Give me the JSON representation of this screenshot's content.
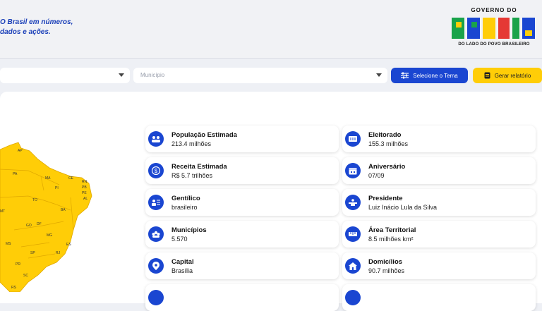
{
  "header": {
    "tagline_line1": "O Brasil em números,",
    "tagline_line2": "dados e ações.",
    "logo_top": "GOVERNO DO",
    "logo_main": "BRASIL",
    "logo_bottom": "DO LADO DO POVO BRASILEIRO"
  },
  "filters": {
    "municipio_placeholder": "Município",
    "theme_button": "Selecione o Tema",
    "report_button": "Gerar relatório"
  },
  "map": {
    "fill_color": "#ffcd07",
    "states": [
      "AP",
      "PA",
      "MA",
      "CE",
      "RN",
      "PB",
      "PE",
      "AL",
      "PI",
      "TO",
      "BA",
      "MT",
      "GO",
      "DF",
      "MG",
      "MS",
      "ES",
      "SP",
      "RJ",
      "PR",
      "SC",
      "RS"
    ]
  },
  "cards": [
    {
      "icon": "people-icon",
      "label": "População Estimada",
      "value": "213.4 milhões"
    },
    {
      "icon": "ballot-icon",
      "label": "Eleitorado",
      "value": "155.3 milhões"
    },
    {
      "icon": "dollar-icon",
      "label": "Receita Estimada",
      "value": "R$ 5.7 trilhões"
    },
    {
      "icon": "calendar-icon",
      "label": "Aniversário",
      "value": "07/09"
    },
    {
      "icon": "person-id-icon",
      "label": "Gentílico",
      "value": "brasileiro"
    },
    {
      "icon": "podium-icon",
      "label": "Presidente",
      "value": "Luiz Inácio Lula da Silva"
    },
    {
      "icon": "group-icon",
      "label": "Municípios",
      "value": "5.570"
    },
    {
      "icon": "ruler-icon",
      "label": "Área Territorial",
      "value": "8.5 milhões km²"
    },
    {
      "icon": "map-pin-icon",
      "label": "Capital",
      "value": "Brasília"
    },
    {
      "icon": "house-icon",
      "label": "Domicílios",
      "value": "90.7 milhões"
    }
  ],
  "colors": {
    "primary": "#1a46d1",
    "accent": "#ffcd07"
  }
}
